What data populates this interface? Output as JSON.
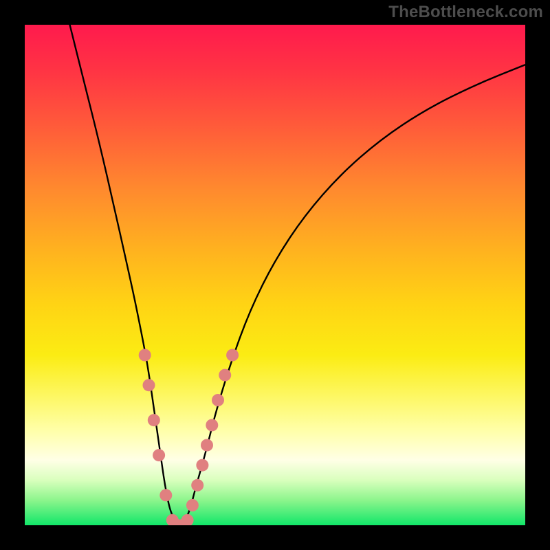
{
  "watermark": "TheBottleneck.com",
  "chart_data": {
    "type": "line",
    "title": "",
    "xlabel": "",
    "ylabel": "",
    "xlim": [
      0,
      100
    ],
    "ylim": [
      0,
      100
    ],
    "x": [
      9,
      12,
      15,
      18,
      20,
      22,
      24,
      25,
      26,
      27,
      28,
      29,
      30,
      31,
      32,
      33,
      34,
      36,
      38,
      41,
      45,
      50,
      56,
      63,
      71,
      80,
      90,
      100
    ],
    "values": [
      100,
      88,
      76,
      63,
      54,
      45,
      35,
      29,
      22,
      15,
      8,
      3,
      1,
      0,
      1,
      3,
      7,
      14,
      22,
      32,
      43,
      53,
      62,
      70,
      77,
      83,
      88,
      92
    ],
    "marker_points": [
      {
        "x": 24.0,
        "y": 34
      },
      {
        "x": 24.8,
        "y": 28
      },
      {
        "x": 25.8,
        "y": 21
      },
      {
        "x": 26.8,
        "y": 14
      },
      {
        "x": 28.2,
        "y": 6
      },
      {
        "x": 29.5,
        "y": 1
      },
      {
        "x": 30.5,
        "y": 0
      },
      {
        "x": 31.5,
        "y": 0
      },
      {
        "x": 32.5,
        "y": 1
      },
      {
        "x": 33.5,
        "y": 4
      },
      {
        "x": 34.5,
        "y": 8
      },
      {
        "x": 35.5,
        "y": 12
      },
      {
        "x": 36.4,
        "y": 16
      },
      {
        "x": 37.4,
        "y": 20
      },
      {
        "x": 38.6,
        "y": 25
      },
      {
        "x": 40.0,
        "y": 30
      },
      {
        "x": 41.5,
        "y": 34
      }
    ],
    "gradient_stops": [
      {
        "pos": 0.0,
        "color": "#ff1a4d"
      },
      {
        "pos": 0.09,
        "color": "#ff3344"
      },
      {
        "pos": 0.2,
        "color": "#ff5a3a"
      },
      {
        "pos": 0.33,
        "color": "#ff8a2e"
      },
      {
        "pos": 0.45,
        "color": "#ffb21f"
      },
      {
        "pos": 0.56,
        "color": "#ffd414"
      },
      {
        "pos": 0.66,
        "color": "#fbec13"
      },
      {
        "pos": 0.74,
        "color": "#fdf761"
      },
      {
        "pos": 0.81,
        "color": "#ffffa8"
      },
      {
        "pos": 0.87,
        "color": "#ffffe6"
      },
      {
        "pos": 0.91,
        "color": "#d9ffbd"
      },
      {
        "pos": 0.95,
        "color": "#8cf58c"
      },
      {
        "pos": 1.0,
        "color": "#11e669"
      }
    ],
    "marker_color": "#e08080",
    "curve_color": "#000000"
  }
}
